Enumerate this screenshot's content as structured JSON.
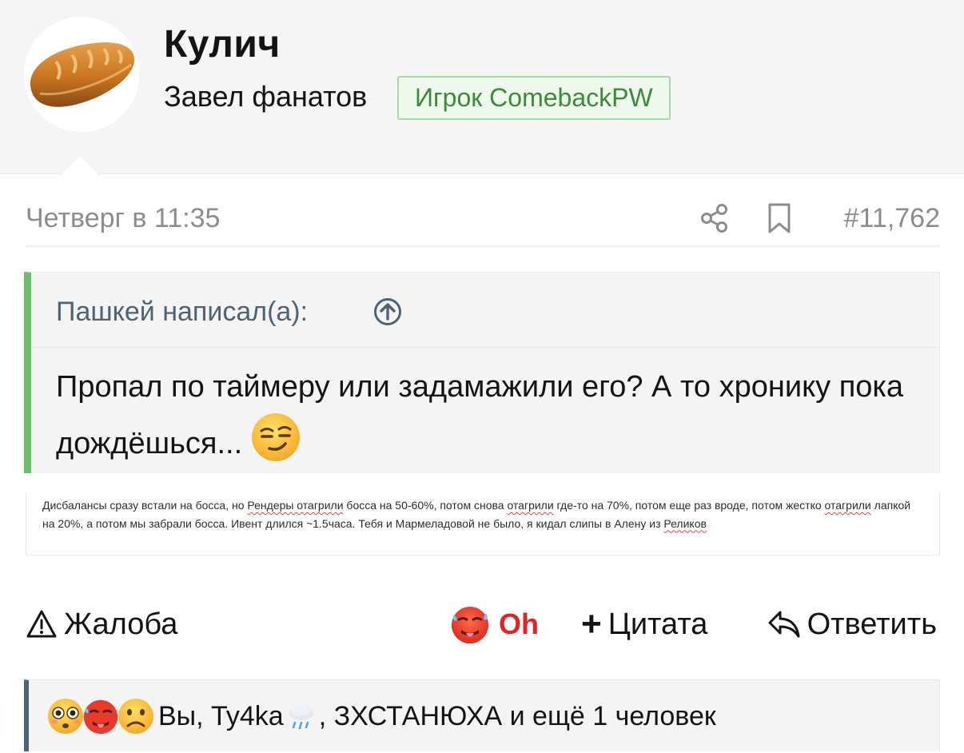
{
  "user": {
    "avatar_icon": "bread-loaf-icon",
    "name": "Кулич",
    "title": "Завел фанатов",
    "badge": "Игрок ComebackPW"
  },
  "post": {
    "date": "Четверг в 11:35",
    "number": "#11,762",
    "share_icon": "share-icon",
    "bookmark_icon": "bookmark-icon"
  },
  "quote": {
    "author": "Пашкей написал(а):",
    "text": "Пропал по таймеру или задамажили его? А то хронику пока дождёшься...",
    "emoji": "smirking-face-icon"
  },
  "attachment": {
    "seg1": "Дисбалансы сразу встали на босса, но ",
    "seg2": "Рендеры отагрили",
    "seg3": " босса на 50-60%, потом снова ",
    "seg4": "отагрили",
    "seg5": " где-то на 70%, потом еще раз вроде, потом жестко ",
    "seg6": "отагрили",
    "seg7": " лапкой на 20%, а потом мы забрали босса. Ивент длился ~1.5часа. Тебя и Мармеладовой не было, я кидал слипы в Алену из ",
    "seg8": "Реликов"
  },
  "actions": {
    "report": "Жалоба",
    "reaction_label": "Oh",
    "quote_plus": "+",
    "quote": "Цитата",
    "reply": "Ответить"
  },
  "reactions": {
    "icons": [
      "flushed-face-icon",
      "hot-face-icon",
      "slightly-frowning-face-icon"
    ],
    "text_before": "Вы, Ty4ka",
    "text_after": ", ЗХСТАНЮХА и ещё 1 человек"
  },
  "colors": {
    "badge_border": "#a8d8a6",
    "badge_text": "#3b8b3a",
    "quote_accent": "#6cbf6a",
    "reactions_accent": "#4e6375",
    "reaction_label": "#e02424"
  }
}
